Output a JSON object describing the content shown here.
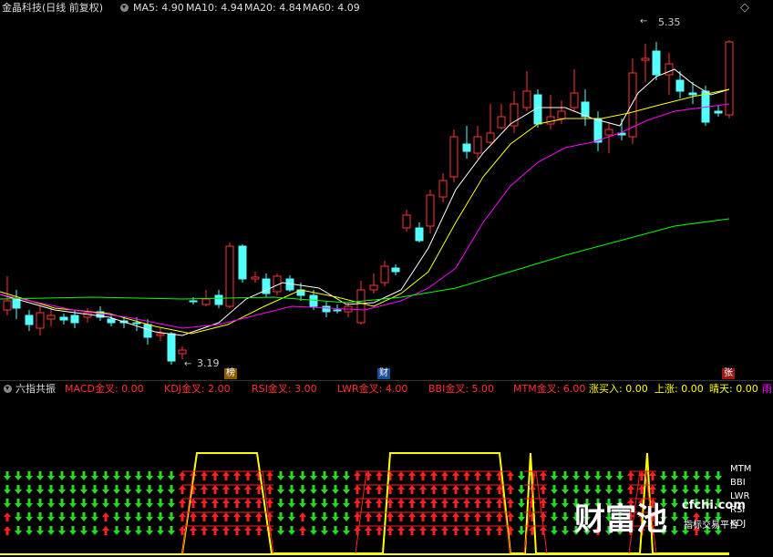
{
  "header": {
    "stock_title": "金晶科技(日线 前复权)",
    "ma_labels": [
      {
        "text": "MA5: 4.90",
        "color": "#ffffff"
      },
      {
        "text": "MA10: 4.94",
        "color": "#ffff00"
      },
      {
        "text": "MA20: 4.84",
        "color": "#ff00ff"
      },
      {
        "text": "MA60: 4.09",
        "color": "#00ff00"
      }
    ],
    "icon": "chevron-down-icon",
    "right_icon": "diamond-icon"
  },
  "main_chart": {
    "high_marker": "5.35",
    "low_marker": "3.19",
    "tags": [
      {
        "text": "榜",
        "bg": "#8b5a00",
        "color": "#ffffff"
      },
      {
        "text": "财",
        "bg": "#1a4a9a",
        "color": "#ffffff"
      },
      {
        "text": "张",
        "bg": "#9a1a1a",
        "color": "#ffffff"
      }
    ]
  },
  "indicator": {
    "title": "六指共振",
    "items": [
      {
        "text": "MACD金叉: 0.00",
        "color": "#ff3030"
      },
      {
        "text": "KDJ金叉: 2.00",
        "color": "#ff3030"
      },
      {
        "text": "RSI金叉: 3.00",
        "color": "#ff3030"
      },
      {
        "text": "LWR金叉: 4.00",
        "color": "#ff3030"
      },
      {
        "text": "BBI金叉: 5.00",
        "color": "#ff3030"
      },
      {
        "text": "MTM金叉: 6.00",
        "color": "#ff3030"
      },
      {
        "text": "涨买入: 0.00",
        "color": "#ffff00"
      },
      {
        "text": "上涨: 0.00",
        "color": "#ffff00"
      },
      {
        "text": "晴天: 0.00",
        "color": "#ffff00"
      },
      {
        "text": "雨",
        "color": "#ff00ff"
      }
    ],
    "right_labels": [
      "MTM",
      "BBI",
      "LWR",
      "RSI",
      "KDJ"
    ]
  },
  "watermark": {
    "logo_text": "财富池",
    "domain": "cfchi.com",
    "subtitle": "指标交易平台"
  },
  "colors": {
    "up": "#ff3232",
    "down": "#54ffff",
    "background": "#000000"
  }
}
